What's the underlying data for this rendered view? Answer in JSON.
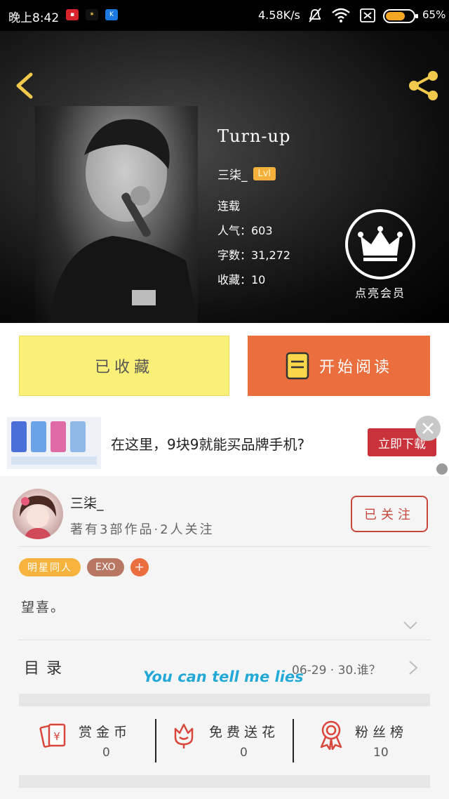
{
  "status_bar": {
    "time": "晚上8:42",
    "net_speed": "4.58K/s",
    "battery": "65%"
  },
  "book": {
    "title": "Turn-up",
    "author": "三柒_",
    "level": "Lvl",
    "status": "连载",
    "popularity": "人气：603",
    "word_count": "字数：31,272",
    "favorites": "收藏：10"
  },
  "vip": {
    "label": "点亮会员"
  },
  "actions": {
    "collected_label": "已收藏",
    "read_label": "开始阅读"
  },
  "ad": {
    "text": "在这里，9块9就能买品牌手机?",
    "cta": "立即下载"
  },
  "author_card": {
    "name": "三柒_",
    "stats": "著有3部作品·2人关注",
    "follow_label": "已关注"
  },
  "tags": [
    "明星同人",
    "EXO",
    "+"
  ],
  "intro": "望喜。",
  "toc": {
    "label": "目录",
    "latest": "06-29 · 30.谁？"
  },
  "subtitle_overlay": "You can tell me lies",
  "stats": [
    {
      "label": "赏金币",
      "value": "0",
      "icon": "red-envelope-yen-icon"
    },
    {
      "label": "免费送花",
      "value": "0",
      "icon": "flower-icon"
    },
    {
      "label": "粉丝榜",
      "value": "10",
      "icon": "medal-icon"
    }
  ],
  "colors": {
    "accent_orange": "#ea6e3e",
    "collect_yellow": "#fbf077",
    "tag_gold": "#f6b33e",
    "tag_brown": "#b77763",
    "follow_red": "#c8473a",
    "icon_red": "#d8463c"
  }
}
